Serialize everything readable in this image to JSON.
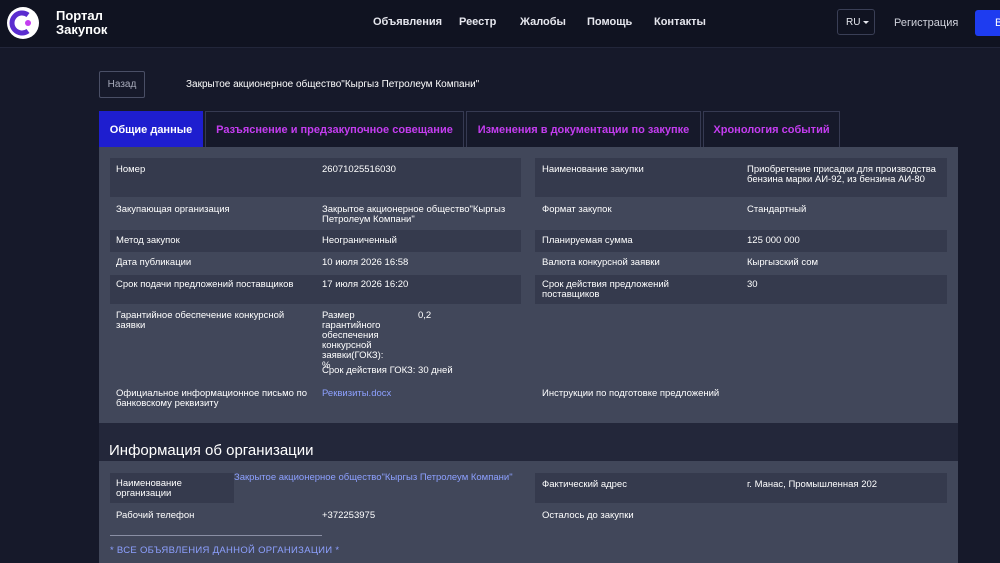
{
  "header": {
    "logo_text_line1": "Портал",
    "logo_text_line2": "Закупок",
    "nav": [
      "Объявления",
      "Реестр",
      "Жалобы",
      "Помощь",
      "Контакты"
    ],
    "lang": "RU",
    "register": "Регистрация",
    "login": "В"
  },
  "back_label": "Назад",
  "org_title": "Закрытое акционерное общество\"Кыргыз Петролеум Компани\"",
  "tabs": [
    "Общие данные",
    "Разъяснение и предзакупочное совещание",
    "Изменения в документации по закупке",
    "Хронология событий"
  ],
  "general": {
    "number_label": "Номер",
    "number_value": "26071025516030",
    "name_label": "Наименование закупки",
    "name_value": "Приобретение присадки для производства бензина марки АИ-92, из бензина АИ-80",
    "buyer_label": "Закупающая организация",
    "buyer_value": "Закрытое акционерное общество\"Кыргыз Петролеум Компани\"",
    "format_label": "Формат закупок",
    "format_value": "Стандартный",
    "method_label": "Метод закупок",
    "method_value": "Неограниченный",
    "planned_label": "Планируемая сумма",
    "planned_value": "125 000 000",
    "pubdate_label": "Дата публикации",
    "pubdate_value": "10 июля 2026 16:58",
    "currency_label": "Валюта конкурсной заявки",
    "currency_value": "Кыргызский сом",
    "deadline_label": "Срок подачи предложений поставщиков",
    "deadline_value": "17 июля 2026 16:20",
    "validity_label": "Срок действия предложений поставщиков",
    "validity_value": "30",
    "guarantee_label": "Гарантийное обеспечение конкурсной заявки",
    "guarantee_size_label": "Размер гарантийного обеспечения конкурсной заявки(ГОКЗ): %",
    "guarantee_size_value": "0,2",
    "guarantee_term": "Срок действия ГОКЗ: 30 дней",
    "letter_label": "Официальное информационное письмо по банковскому реквизиту",
    "letter_link": "Реквизиты.docx",
    "instructions_label": "Инструкции по подготовке предложений"
  },
  "org_section": {
    "title": "Информация об организации",
    "name_label": "Наименование организации",
    "name_value": "Закрытое акционерное общество\"Кыргыз Петролеум Компани\"",
    "address_label": "Фактический адрес",
    "address_value": "г. Манас, Промышленная 202",
    "phone_label": "Рабочий телефон",
    "phone_value": "+372253975",
    "left_label": "Осталось до закупки",
    "all_link": "* ВСЕ ОБЪЯВЛЕНИЯ ДАННОЙ ОРГАНИЗАЦИИ *"
  },
  "colors": {
    "accent_blue": "#1e1ecf",
    "tab_text": "#c43df0",
    "link": "#8da0ff",
    "background": "#16192a",
    "panel": "#41475a"
  }
}
